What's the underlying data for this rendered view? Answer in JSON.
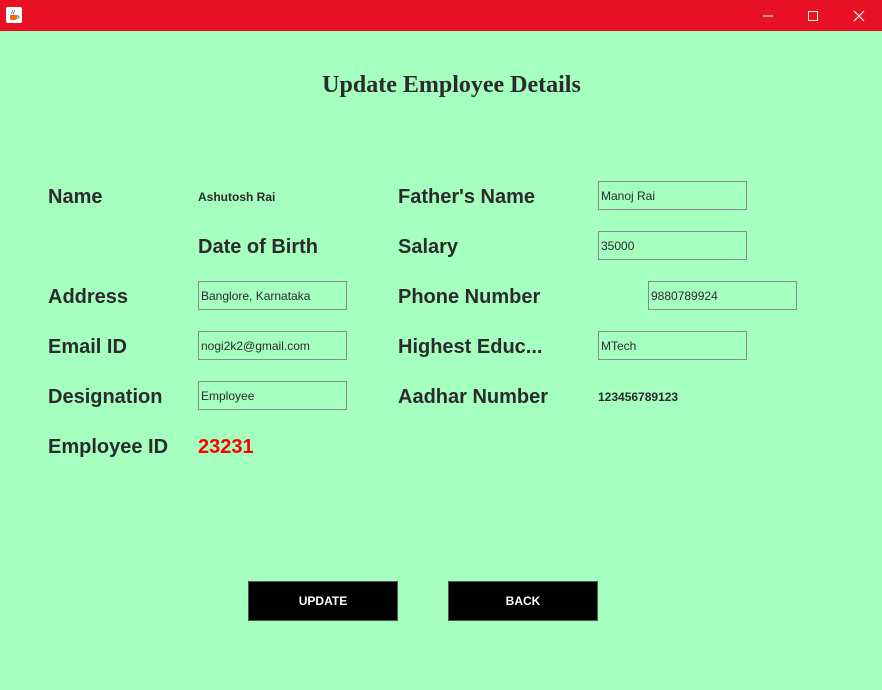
{
  "window": {
    "app_icon": "java-cup-icon",
    "controls": [
      "minimize-icon",
      "maximize-icon",
      "close-icon"
    ],
    "titlebar_color": "#e81123"
  },
  "heading": "Update Employee Details",
  "labels": {
    "name": "Name",
    "fathers_name": "Father's Name",
    "dob": "Date of Birth",
    "salary": "Salary",
    "address": "Address",
    "phone": "Phone Number",
    "email": "Email ID",
    "education": "Highest Educ...",
    "designation": "Designation",
    "aadhar": "Aadhar Number",
    "employee_id": "Employee ID"
  },
  "values": {
    "name": "Ashutosh Rai",
    "fathers_name": "Manoj Rai",
    "salary": "35000",
    "address": "Banglore, Karnataka",
    "phone": "9880789924",
    "email": "nogi2k2@gmail.com",
    "education": "MTech",
    "designation": "Employee",
    "aadhar": "123456789123",
    "employee_id": "23231"
  },
  "buttons": {
    "update": "UPDATE",
    "back": "BACK"
  },
  "colors": {
    "background": "#a5ffbf",
    "employee_id": "#ff0000",
    "button": "#000000"
  }
}
